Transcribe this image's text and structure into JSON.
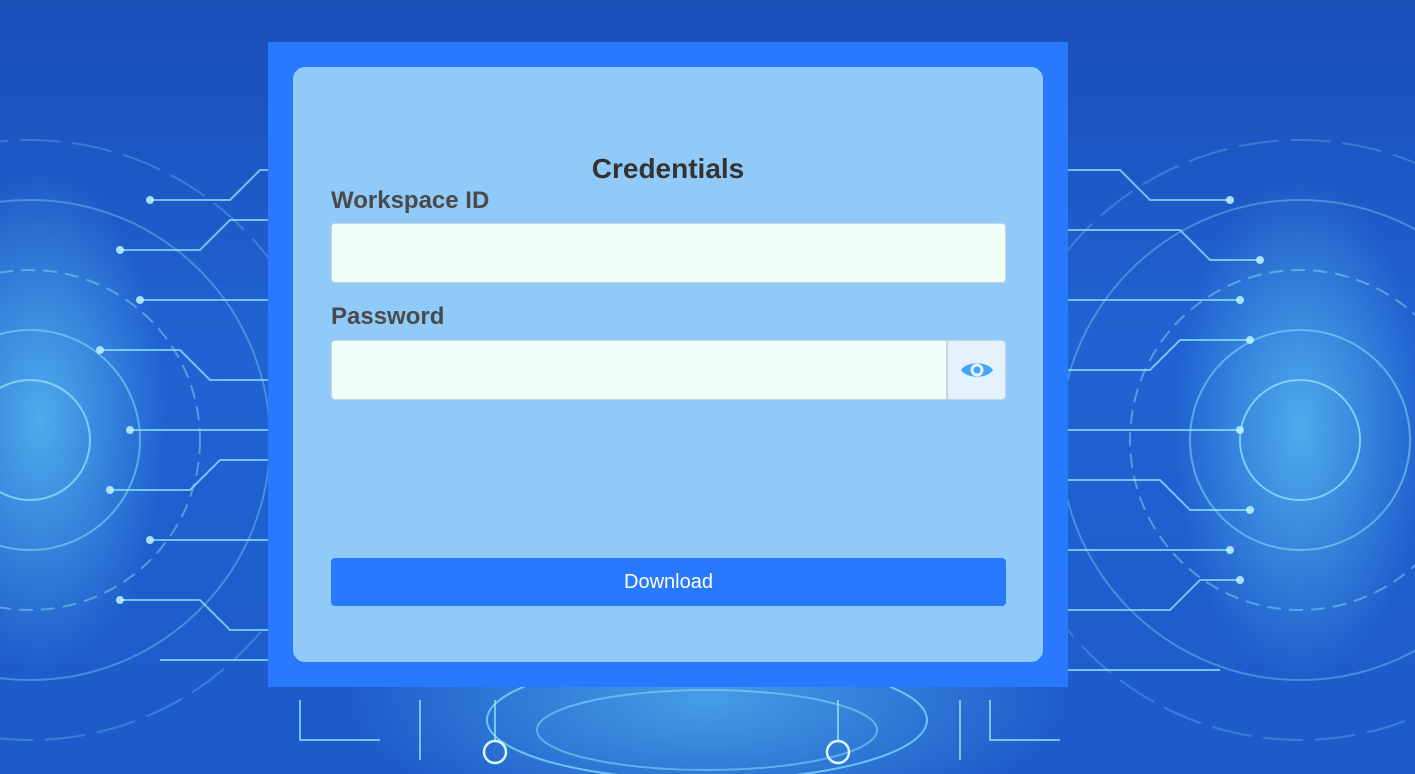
{
  "form": {
    "title": "Credentials",
    "workspace_label": "Workspace ID",
    "workspace_value": "",
    "password_label": "Password",
    "password_value": "",
    "toggle_icon": "eye-icon",
    "download_label": "Download"
  },
  "colors": {
    "frame": "#2979ff",
    "card": "#90caf9",
    "input_bg": "#f0fff8",
    "button": "#2979ff",
    "eye_icon": "#42a5f5",
    "background": "#1f63d2"
  }
}
